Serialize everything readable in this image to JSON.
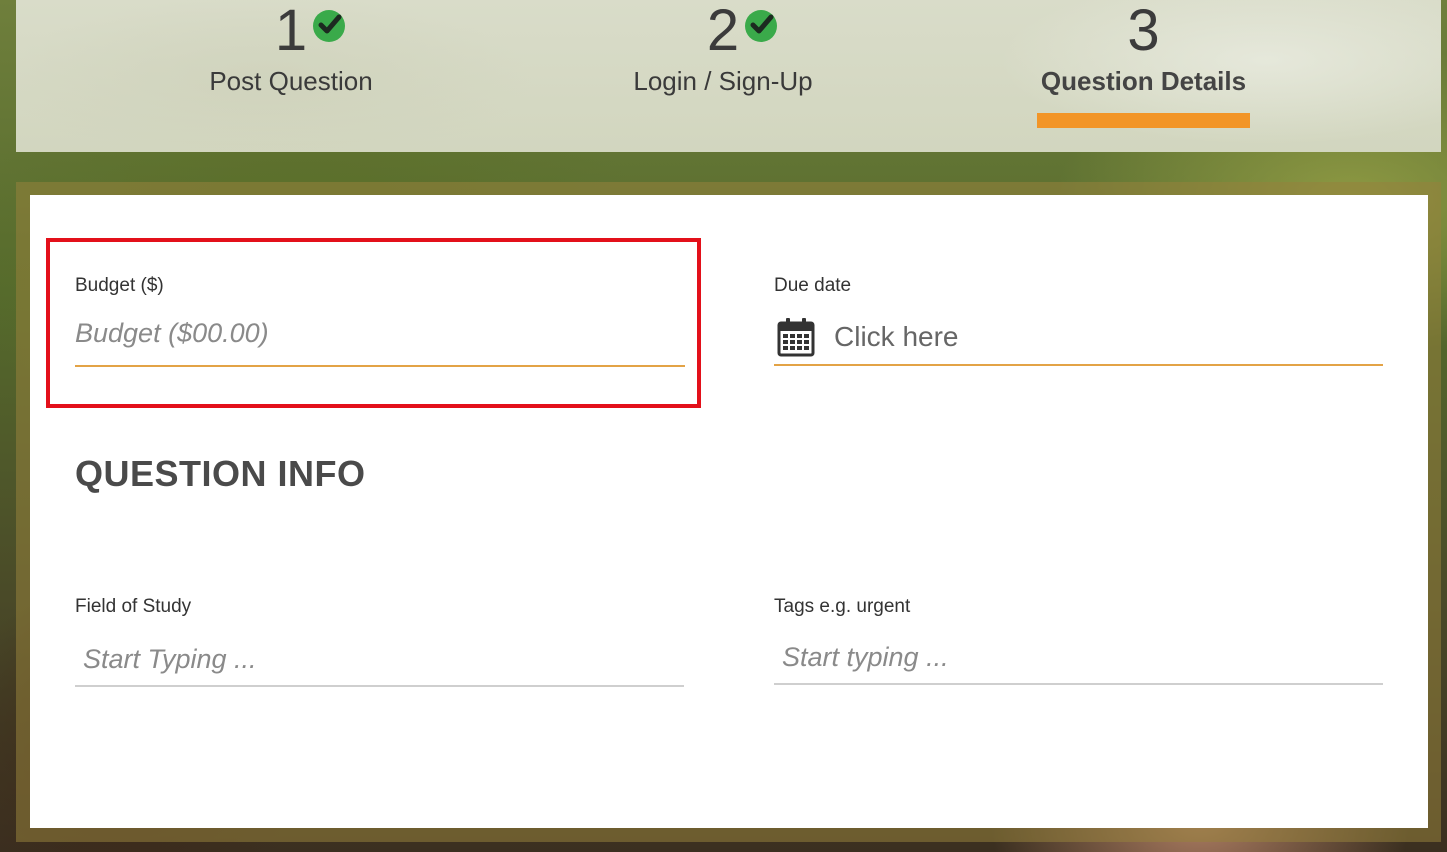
{
  "steps": [
    {
      "number": "1",
      "label": "Post Question",
      "completed": true
    },
    {
      "number": "2",
      "label": "Login / Sign-Up",
      "completed": true
    },
    {
      "number": "3",
      "label": "Question Details",
      "completed": false,
      "active": true
    }
  ],
  "form": {
    "budget": {
      "label": "Budget ($)",
      "placeholder": "Budget ($00.00)",
      "value": ""
    },
    "due_date": {
      "label": "Due date",
      "prompt": "Click here",
      "icon": "calendar-icon"
    },
    "section_title": "QUESTION INFO",
    "field_of_study": {
      "label": "Field of Study",
      "placeholder": "Start Typing ...",
      "value": ""
    },
    "tags": {
      "label": "Tags e.g. urgent",
      "placeholder": "Start typing ...",
      "value": ""
    }
  },
  "colors": {
    "accent": "#f29527",
    "field_underline_active": "#e3a346",
    "field_underline": "#cfcfcf",
    "check": "#3aaa4a",
    "highlight": "#e3101a"
  }
}
